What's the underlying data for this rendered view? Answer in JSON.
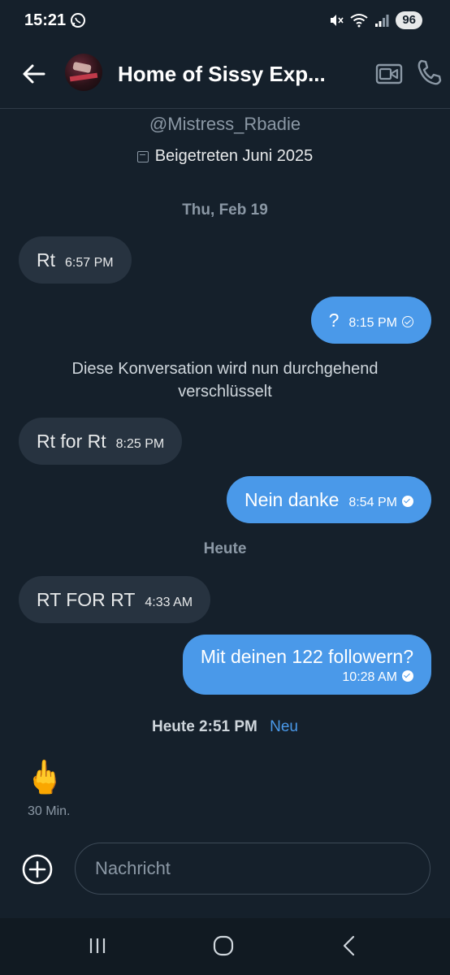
{
  "status_bar": {
    "time": "15:21",
    "battery": "96",
    "icons": [
      "whatsapp-icon",
      "mute-icon",
      "wifi-icon",
      "signal-icon"
    ]
  },
  "header": {
    "title": "Home of Sissy Exp...",
    "back_icon": "arrow-left-icon",
    "video_icon": "video-call-icon",
    "call_icon": "phone-icon"
  },
  "profile": {
    "handle": "@Mistress_Rbadie",
    "joined": "Beigetreten Juni 2025"
  },
  "conversation": {
    "date_1": "Thu, Feb 19",
    "messages_a": [
      {
        "dir": "in",
        "text": "Rt",
        "time": "6:57 PM"
      },
      {
        "dir": "out",
        "text": "?",
        "time": "8:15 PM",
        "status": "sent"
      }
    ],
    "encryption_note": "Diese Konversation wird nun durchgehend verschlüsselt",
    "messages_b": [
      {
        "dir": "in",
        "text": "Rt for Rt",
        "time": "8:25 PM"
      },
      {
        "dir": "out",
        "text": "Nein danke",
        "time": "8:54 PM",
        "status": "read"
      }
    ],
    "date_2": "Heute",
    "messages_c": [
      {
        "dir": "in",
        "text": "RT FOR RT",
        "time": "4:33 AM"
      },
      {
        "dir": "out",
        "text": "Mit deinen 122 followern?",
        "time": "10:28 AM",
        "status": "read"
      }
    ],
    "new_separator": {
      "time": "Heute 2:51 PM",
      "label": "Neu"
    },
    "last_message": {
      "dir": "in",
      "emoji": "🖕",
      "time": "30 Min."
    }
  },
  "composer": {
    "placeholder": "Nachricht",
    "value": ""
  },
  "colors": {
    "background": "#15202b",
    "bubble_in": "#273340",
    "bubble_out": "#4a99e9",
    "accent": "#4a99e9"
  }
}
